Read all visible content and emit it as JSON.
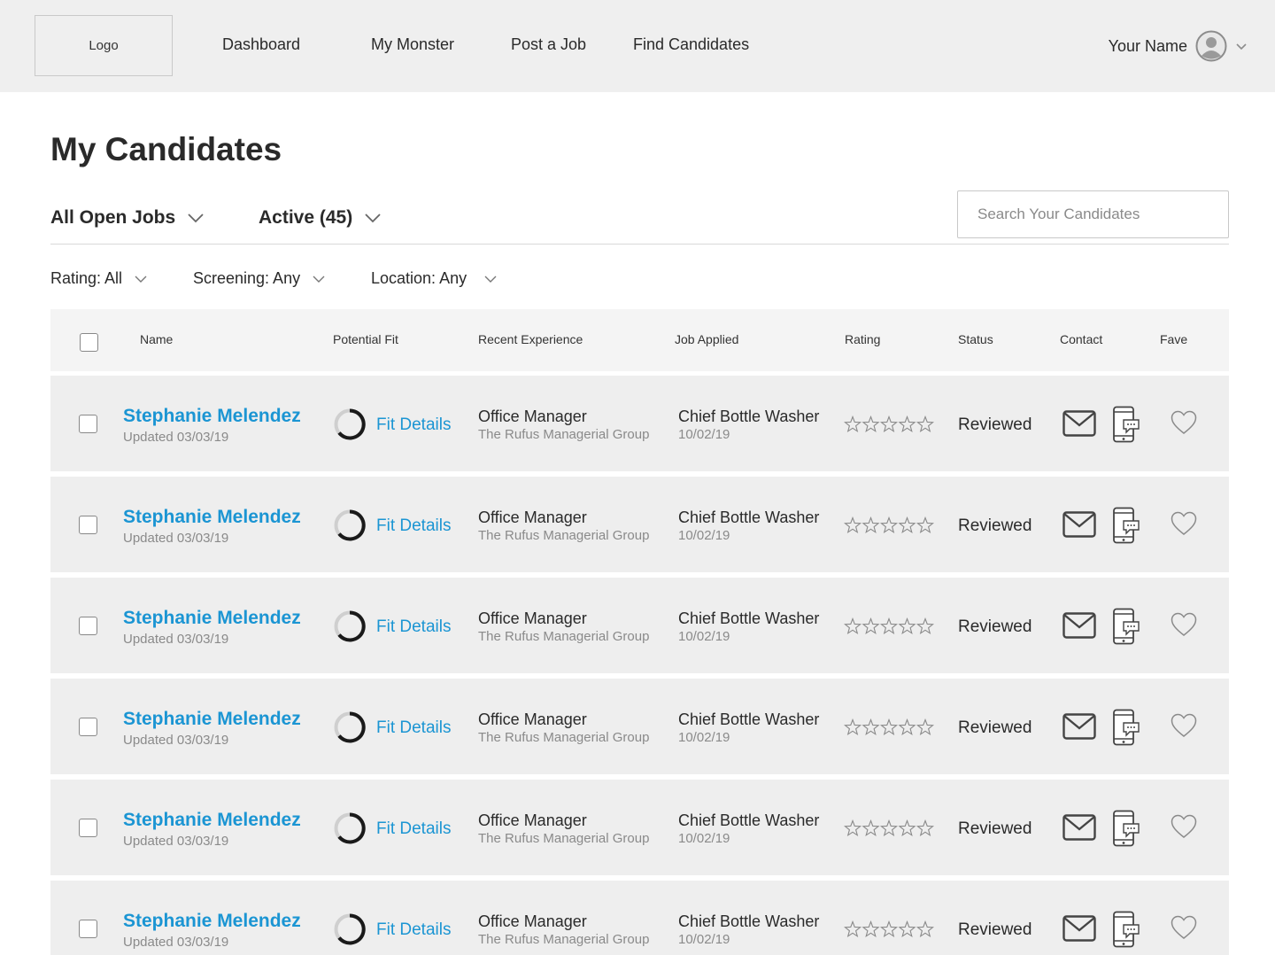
{
  "header": {
    "logo": "Logo",
    "nav": [
      "Dashboard",
      "My Monster",
      "Post a Job",
      "Find Candidates"
    ],
    "user_name": "Your Name"
  },
  "page": {
    "title": "My Candidates"
  },
  "filters": {
    "jobs": "All Open Jobs",
    "active": "Active (45)",
    "search_placeholder": "Search Your Candidates",
    "rating": "Rating: All",
    "screening": "Screening: Any",
    "location": "Location: Any"
  },
  "table": {
    "columns": [
      "Name",
      "Potential Fit",
      "Recent Experience",
      "Job Applied",
      "Rating",
      "Status",
      "Contact",
      "Fave"
    ],
    "rows": [
      {
        "name": "Stephanie Melendez",
        "updated": "Updated 03/03/19",
        "fit": "Fit Details",
        "exp_title": "Office Manager",
        "exp_company": "The Rufus Managerial Group",
        "job": "Chief Bottle Washer",
        "job_date": "10/02/19",
        "rating": 0,
        "status": "Reviewed"
      },
      {
        "name": "Stephanie Melendez",
        "updated": "Updated 03/03/19",
        "fit": "Fit Details",
        "exp_title": "Office Manager",
        "exp_company": "The Rufus Managerial Group",
        "job": "Chief Bottle Washer",
        "job_date": "10/02/19",
        "rating": 0,
        "status": "Reviewed"
      },
      {
        "name": "Stephanie Melendez",
        "updated": "Updated 03/03/19",
        "fit": "Fit Details",
        "exp_title": "Office Manager",
        "exp_company": "The Rufus Managerial Group",
        "job": "Chief Bottle Washer",
        "job_date": "10/02/19",
        "rating": 0,
        "status": "Reviewed"
      },
      {
        "name": "Stephanie Melendez",
        "updated": "Updated 03/03/19",
        "fit": "Fit Details",
        "exp_title": "Office Manager",
        "exp_company": "The Rufus Managerial Group",
        "job": "Chief Bottle Washer",
        "job_date": "10/02/19",
        "rating": 0,
        "status": "Reviewed"
      },
      {
        "name": "Stephanie Melendez",
        "updated": "Updated 03/03/19",
        "fit": "Fit Details",
        "exp_title": "Office Manager",
        "exp_company": "The Rufus Managerial Group",
        "job": "Chief Bottle Washer",
        "job_date": "10/02/19",
        "rating": 0,
        "status": "Reviewed"
      },
      {
        "name": "Stephanie Melendez",
        "updated": "Updated 03/03/19",
        "fit": "Fit Details",
        "exp_title": "Office Manager",
        "exp_company": "The Rufus Managerial Group",
        "job": "Chief Bottle Washer",
        "job_date": "10/02/19",
        "rating": 0,
        "status": "Reviewed"
      }
    ]
  },
  "colors": {
    "accent": "#1b95d3",
    "header_bg": "#efefef",
    "row_bg": "#eeeeee",
    "muted_text": "#8a8a8a"
  },
  "icons": {
    "avatar": "user-avatar-icon",
    "chevron": "chevron-down-icon",
    "fit": "fit-ring-icon",
    "rating": "star-icon",
    "email": "email-icon",
    "phone": "phone-icon",
    "fave": "heart-icon"
  }
}
